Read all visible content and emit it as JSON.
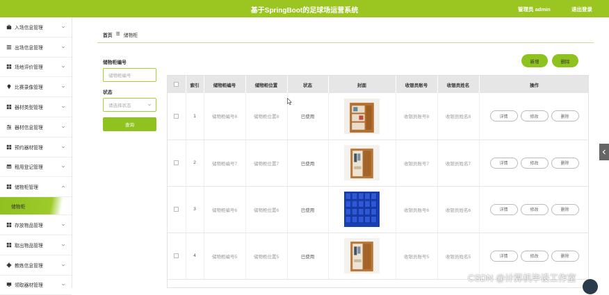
{
  "header": {
    "title": "基于SpringBoot的足球场运营系统",
    "user": "管理员 admin",
    "logout": "退出登录",
    "bg_color": "#9bc521"
  },
  "sidebar": {
    "items": [
      {
        "label": "入场信息管理",
        "icon": "briefcase-icon"
      },
      {
        "label": "出场信息管理",
        "icon": "list-icon"
      },
      {
        "label": "场地评价管理",
        "icon": "grid-icon"
      },
      {
        "label": "比赛录像管理",
        "icon": "pin-icon"
      },
      {
        "label": "器材类型管理",
        "icon": "grid-icon"
      },
      {
        "label": "器材信息管理",
        "icon": "sliders-icon"
      },
      {
        "label": "预约器材管理",
        "icon": "grid-icon"
      },
      {
        "label": "租用登记管理",
        "icon": "table-icon"
      },
      {
        "label": "储物柜管理",
        "icon": "grid-icon",
        "expanded": true
      },
      {
        "label": "存放物品管理",
        "icon": "grid-icon"
      },
      {
        "label": "取出物品管理",
        "icon": "grid-icon"
      },
      {
        "label": "教练信息管理",
        "icon": "gear-icon"
      },
      {
        "label": "领取器材管理",
        "icon": "monitor-icon"
      }
    ],
    "active_sub": "储物柜"
  },
  "breadcrumb": {
    "home": "首页",
    "sep": "☰",
    "current": "储物柜"
  },
  "search": {
    "code_label": "储物柜编号",
    "code_placeholder": "储物柜编号",
    "status_label": "状态",
    "status_placeholder": "请选择状态",
    "query_button": "查询"
  },
  "actions": {
    "add": "新增",
    "delete": "删除"
  },
  "table": {
    "headers": [
      "",
      "索引",
      "储物柜编号",
      "储物柜位置",
      "状态",
      "封面",
      "收银员账号",
      "收银员姓名",
      "操作"
    ],
    "rows": [
      {
        "index": "1",
        "code": "储物柜编号8",
        "location": "储物柜位置8",
        "status": "已使用",
        "cover": "shelf-cabinet",
        "account": "收银员账号8",
        "name": "收银员姓名8"
      },
      {
        "index": "2",
        "code": "储物柜编号7",
        "location": "储物柜位置7",
        "status": "已使用",
        "cover": "wardrobe-cabinet",
        "account": "收银员账号7",
        "name": "收银员姓名7"
      },
      {
        "index": "3",
        "code": "储物柜编号6",
        "location": "储物柜位置6",
        "status": "已使用",
        "cover": "blue-lockers",
        "account": "收银员账号6",
        "name": "收银员姓名6"
      },
      {
        "index": "4",
        "code": "储物柜编号5",
        "location": "储物柜位置5",
        "status": "已使用",
        "cover": "wardrobe-cabinet",
        "account": "收银员账号5",
        "name": "收银员姓名5"
      }
    ],
    "op_labels": {
      "detail": "详情",
      "edit": "修改",
      "delete": "删除"
    }
  },
  "watermark": "CSDN @计算机毕设工作室"
}
